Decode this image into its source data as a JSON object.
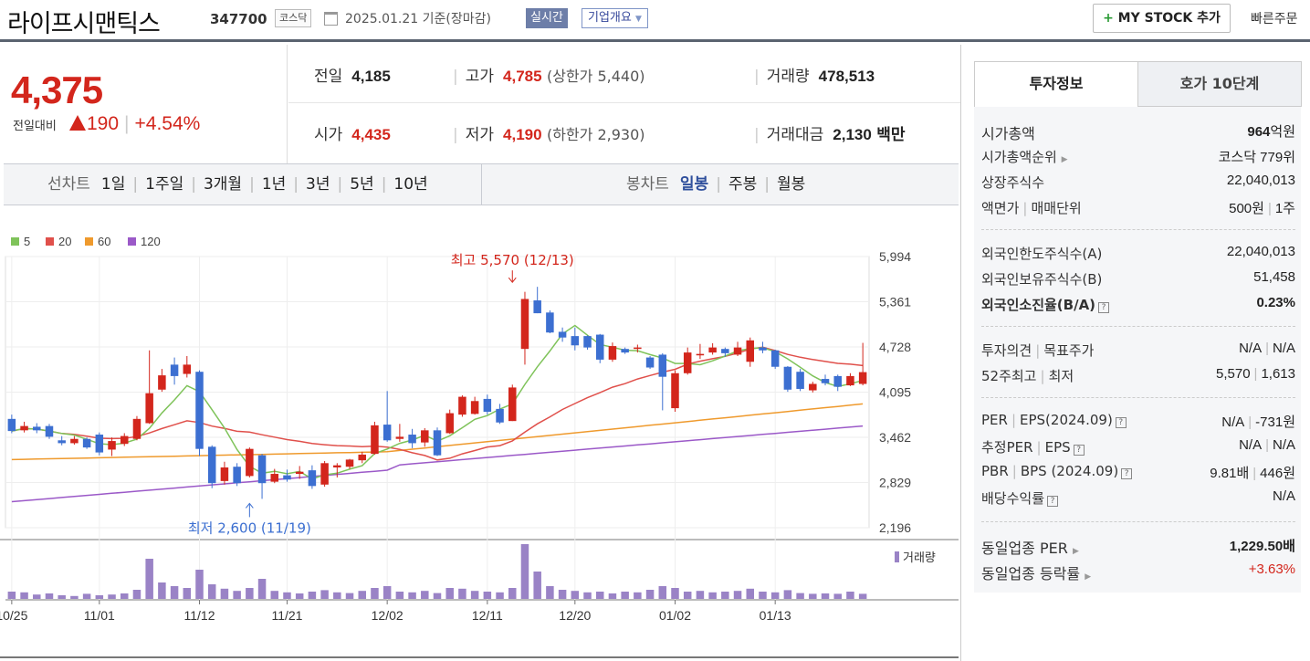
{
  "header": {
    "name": "라이프시맨틱스",
    "code": "347700",
    "market": "코스닥",
    "date": "2025.01.21 기준(장마감)",
    "realtime": "실시간",
    "company": "기업개요",
    "mystock": "MY STOCK 추가",
    "quick": "빠른주문"
  },
  "price": {
    "current": "4,375",
    "change_label": "전일대비",
    "change": "190",
    "change_pct": "+4.54%"
  },
  "stats": {
    "prev_label": "전일",
    "prev": "4,185",
    "high_label": "고가",
    "high": "4,785",
    "upper": "(상한가 5,440)",
    "vol_label": "거래량",
    "vol": "478,513",
    "open_label": "시가",
    "open": "4,435",
    "low_label": "저가",
    "low": "4,190",
    "lower": "(하한가 2,930)",
    "amt_label": "거래대금",
    "amt": "2,130",
    "amt_unit": "백만"
  },
  "tabs": {
    "line_label": "선차트",
    "line": [
      "1일",
      "1주일",
      "3개월",
      "1년",
      "3년",
      "5년",
      "10년"
    ],
    "candle_label": "봉차트",
    "candle": [
      "일봉",
      "주봉",
      "월봉"
    ],
    "active_candle": "일봉"
  },
  "panel": {
    "tab_a": "투자정보",
    "tab_b": "호가 10단계",
    "mcap_k": "시가총액",
    "mcap_v": "964",
    "mcap_u": "억원",
    "rank_k": "시가총액순위",
    "rank_v": "코스닥 779위",
    "shares_k": "상장주식수",
    "shares_v": "22,040,013",
    "par_k1": "액면가",
    "par_k2": "매매단위",
    "par_v1": "500원",
    "par_v2": "1주",
    "flimit_k": "외국인한도주식수(A)",
    "flimit_v": "22,040,013",
    "fhold_k": "외국인보유주식수(B)",
    "fhold_v": "51,458",
    "fratio_k": "외국인소진율(B/A)",
    "fratio_v": "0.23%",
    "op_k1": "투자의견",
    "op_k2": "목표주가",
    "op_v1": "N/A",
    "op_v2": "N/A",
    "w52_k1": "52주최고",
    "w52_k2": "최저",
    "w52_v1": "5,570",
    "w52_v2": "1,613",
    "per_k1": "PER",
    "per_k2": "EPS(2024.09)",
    "per_v1": "N/A",
    "per_v2": "-731원",
    "eper_k1": "추정PER",
    "eper_k2": "EPS",
    "eper_v1": "N/A",
    "eper_v2": "N/A",
    "pbr_k1": "PBR",
    "pbr_k2": "BPS (2024.09)",
    "pbr_v1": "9.81배",
    "pbr_v2": "446원",
    "div_k": "배당수익률",
    "div_v": "N/A",
    "sper_k": "동일업종 PER",
    "sper_v": "1,229.50배",
    "srate_k": "동일업종 등락률",
    "srate_v": "+3.63%"
  },
  "colors": {
    "up": "#d3261c",
    "down": "#3c6fd1",
    "ma5": "#7fc35a",
    "ma20": "#e0504b",
    "ma60": "#ef9a2d",
    "ma120": "#9b59c8",
    "volume": "#9a83c6"
  },
  "chart_data": {
    "type": "candlestick",
    "legend": [
      "5",
      "20",
      "60",
      "120"
    ],
    "y_ticks": [
      "5,994",
      "5,361",
      "4,728",
      "4,095",
      "3,462",
      "2,829",
      "2,196"
    ],
    "ylim": [
      2196,
      5994
    ],
    "x_ticks": [
      "10/25",
      "11/01",
      "11/12",
      "11/21",
      "12/02",
      "12/11",
      "12/20",
      "01/02",
      "01/13"
    ],
    "x_tick_index": [
      0,
      7,
      15,
      22,
      30,
      38,
      45,
      53,
      61
    ],
    "high_note": "최고 5,570 (12/13)",
    "low_note": "최저 2,600 (11/19)",
    "high_index": 40,
    "high_value": 5570,
    "low_index": 19,
    "low_value": 2600,
    "volume_label": "거래량",
    "candles": [
      [
        3720,
        3550,
        3780,
        3520
      ],
      [
        3560,
        3620,
        3680,
        3530
      ],
      [
        3610,
        3560,
        3660,
        3520
      ],
      [
        3620,
        3470,
        3650,
        3440
      ],
      [
        3420,
        3380,
        3480,
        3350
      ],
      [
        3380,
        3440,
        3480,
        3360
      ],
      [
        3440,
        3320,
        3460,
        3300
      ],
      [
        3500,
        3250,
        3530,
        3210
      ],
      [
        3290,
        3410,
        3460,
        3200
      ],
      [
        3370,
        3480,
        3520,
        3340
      ],
      [
        3440,
        3720,
        3760,
        3420
      ],
      [
        3660,
        4080,
        4680,
        3650
      ],
      [
        4130,
        4330,
        4420,
        4100
      ],
      [
        4480,
        4320,
        4580,
        4200
      ],
      [
        4350,
        4480,
        4600,
        4300
      ],
      [
        4380,
        3300,
        4400,
        3200
      ],
      [
        3330,
        2820,
        3350,
        2750
      ],
      [
        2850,
        3040,
        3120,
        2800
      ],
      [
        3050,
        2820,
        3100,
        2780
      ],
      [
        2920,
        3300,
        3320,
        2900
      ],
      [
        3210,
        2820,
        3230,
        2600
      ],
      [
        2840,
        2950,
        3020,
        2820
      ],
      [
        2930,
        2870,
        3010,
        2840
      ],
      [
        2950,
        2980,
        3060,
        2880
      ],
      [
        3000,
        2780,
        3070,
        2740
      ],
      [
        2800,
        3100,
        3130,
        2770
      ],
      [
        3040,
        3070,
        3100,
        2900
      ],
      [
        3050,
        3150,
        3160,
        3020
      ],
      [
        3140,
        3220,
        3260,
        3100
      ],
      [
        3230,
        3630,
        3680,
        3220
      ],
      [
        3640,
        3420,
        4110,
        3400
      ],
      [
        3440,
        3470,
        3650,
        3400
      ],
      [
        3500,
        3380,
        3580,
        3310
      ],
      [
        3390,
        3560,
        3590,
        3330
      ],
      [
        3560,
        3210,
        3600,
        3200
      ],
      [
        3520,
        3800,
        3850,
        3510
      ],
      [
        3780,
        4030,
        4050,
        3750
      ],
      [
        3790,
        3970,
        4030,
        3780
      ],
      [
        4000,
        3820,
        4060,
        3780
      ],
      [
        3860,
        3670,
        3930,
        3650
      ],
      [
        3690,
        4160,
        4200,
        3690
      ],
      [
        4700,
        5400,
        5500,
        4480
      ],
      [
        5380,
        5200,
        5570,
        5200
      ],
      [
        5210,
        4930,
        5240,
        4920
      ],
      [
        4940,
        4860,
        5000,
        4800
      ],
      [
        4880,
        4750,
        5000,
        4680
      ],
      [
        4880,
        4720,
        4890,
        4690
      ],
      [
        4900,
        4550,
        4910,
        4500
      ],
      [
        4550,
        4740,
        4790,
        4520
      ],
      [
        4700,
        4650,
        4720,
        4630
      ],
      [
        4700,
        4720,
        4760,
        4650
      ],
      [
        4580,
        4440,
        4600,
        4420
      ],
      [
        4620,
        4310,
        4640,
        3840
      ],
      [
        3870,
        4360,
        4400,
        3820
      ],
      [
        4360,
        4650,
        4720,
        4340
      ],
      [
        4610,
        4630,
        4770,
        4560
      ],
      [
        4650,
        4720,
        4780,
        4620
      ],
      [
        4700,
        4640,
        4720,
        4590
      ],
      [
        4620,
        4720,
        4800,
        4600
      ],
      [
        4520,
        4820,
        4860,
        4450
      ],
      [
        4720,
        4680,
        4800,
        4640
      ],
      [
        4680,
        4450,
        4690,
        4420
      ],
      [
        4450,
        4130,
        4460,
        4100
      ],
      [
        4380,
        4140,
        4420,
        4110
      ],
      [
        4120,
        4210,
        4240,
        4090
      ],
      [
        4280,
        4220,
        4340,
        4190
      ],
      [
        4320,
        4170,
        4340,
        4110
      ],
      [
        4190,
        4320,
        4360,
        4180
      ],
      [
        4210,
        4375,
        4785,
        4190
      ]
    ],
    "volume": [
      20,
      18,
      12,
      15,
      10,
      8,
      14,
      10,
      12,
      15,
      25,
      110,
      45,
      35,
      30,
      80,
      40,
      28,
      22,
      30,
      55,
      22,
      18,
      15,
      20,
      24,
      18,
      16,
      22,
      30,
      35,
      20,
      18,
      22,
      16,
      30,
      28,
      22,
      20,
      18,
      30,
      150,
      75,
      35,
      25,
      22,
      18,
      20,
      15,
      20,
      18,
      25,
      35,
      30,
      20,
      22,
      18,
      20,
      22,
      28,
      20,
      18,
      24,
      16,
      14,
      15,
      14,
      20,
      14
    ]
  }
}
